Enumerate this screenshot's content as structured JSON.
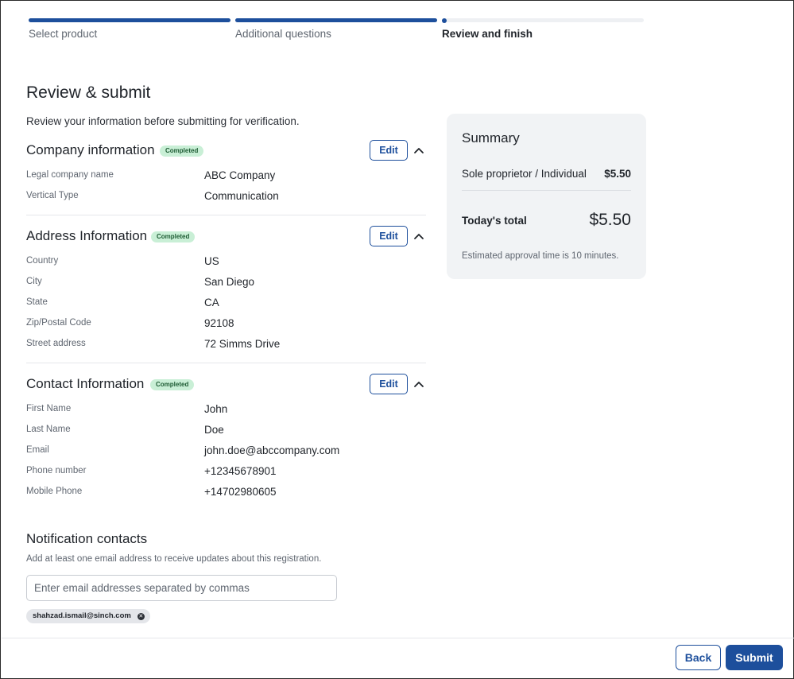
{
  "stepper": {
    "steps": [
      {
        "label": "Select product",
        "state": "done"
      },
      {
        "label": "Additional questions",
        "state": "done"
      },
      {
        "label": "Review and finish",
        "state": "current"
      }
    ]
  },
  "page": {
    "title": "Review & submit",
    "subtitle": "Review your information before submitting for verification."
  },
  "sections": {
    "company": {
      "title": "Company information",
      "badge": "Completed",
      "edit_label": "Edit",
      "rows": [
        {
          "label": "Legal company name",
          "value": "ABC Company"
        },
        {
          "label": "Vertical Type",
          "value": "Communication"
        }
      ]
    },
    "address": {
      "title": "Address Information",
      "badge": "Completed",
      "edit_label": "Edit",
      "rows": [
        {
          "label": "Country",
          "value": "US"
        },
        {
          "label": "City",
          "value": "San Diego"
        },
        {
          "label": "State",
          "value": "CA"
        },
        {
          "label": "Zip/Postal Code",
          "value": "92108"
        },
        {
          "label": "Street address",
          "value": "72 Simms Drive"
        }
      ]
    },
    "contact": {
      "title": "Contact Information",
      "badge": "Completed",
      "edit_label": "Edit",
      "rows": [
        {
          "label": "First Name",
          "value": "John"
        },
        {
          "label": "Last Name",
          "value": "Doe"
        },
        {
          "label": "Email",
          "value": "john.doe@abccompany.com"
        },
        {
          "label": "Phone number",
          "value": "+12345678901"
        },
        {
          "label": "Mobile Phone",
          "value": "+14702980605"
        }
      ]
    }
  },
  "notification": {
    "title": "Notification contacts",
    "description": "Add at least one email address to receive updates about this registration.",
    "input_value": "",
    "input_placeholder": "Enter email addresses separated by commas",
    "chips": [
      "shahzad.ismail@sinch.com"
    ]
  },
  "summary": {
    "title": "Summary",
    "item_label": "Sole proprietor / Individual",
    "item_price": "$5.50",
    "total_label": "Today's total",
    "total_value": "$5.50",
    "note": "Estimated approval time is 10 minutes."
  },
  "footer": {
    "back_label": "Back",
    "submit_label": "Submit"
  },
  "colors": {
    "primary": "#1d4f9c",
    "badge_bg": "#c9efd6",
    "badge_text": "#1d5b33",
    "summary_bg": "#f1f3f5"
  },
  "icons": {
    "collapse": "chevron-up-icon",
    "chip_remove": "close-circle-icon"
  }
}
